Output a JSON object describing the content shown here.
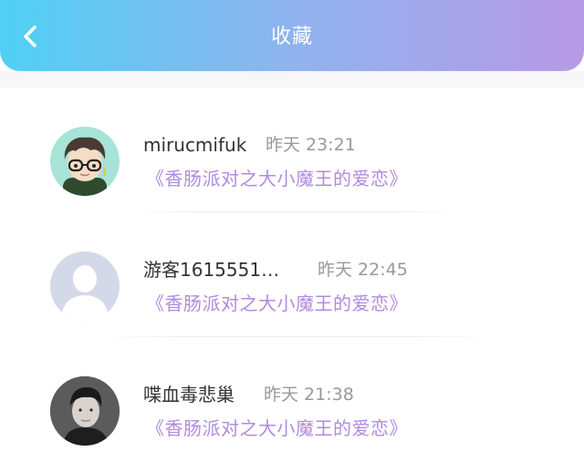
{
  "header": {
    "title": "收藏",
    "back_icon": "chevron-left-icon"
  },
  "favorites": [
    {
      "username": "mirucmifuk",
      "time": "昨天 23:21",
      "work_title": "《香肠派对之大小魔王的爱恋》",
      "avatar": "cartoon-boy-avatar"
    },
    {
      "username": "游客1615551…",
      "time": "昨天 22:45",
      "work_title": "《香肠派对之大小魔王的爱恋》",
      "avatar": "default-user-avatar"
    },
    {
      "username": "喋血毒悲巢",
      "time": "昨天 21:38",
      "work_title": "《香肠派对之大小魔王的爱恋》",
      "avatar": "photo-avatar"
    }
  ],
  "colors": {
    "header_gradient_start": "#4fd0f4",
    "header_gradient_end": "#b89ae6",
    "work_title": "#b08adf",
    "time": "#999999"
  }
}
